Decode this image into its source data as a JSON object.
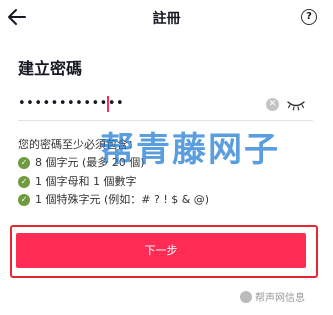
{
  "header": {
    "title": "註冊",
    "help_label": "?"
  },
  "heading": "建立密碼",
  "password": {
    "value": "•••••••••••••",
    "clear_label": "✕"
  },
  "requirements": {
    "title": "您的密碼至少必須包含：",
    "items": [
      {
        "label": "8 個字元 (最多 20 個)"
      },
      {
        "label": "1 個字母和 1 個數字"
      },
      {
        "label": "1 個特殊字元 (例如：# ? ! $ & @)"
      }
    ]
  },
  "watermark": "帮青藤网子",
  "next_button": {
    "label": "下一步"
  },
  "source_mark": {
    "label": "帮声网信息"
  },
  "colors": {
    "primary": "#fe2c55",
    "check": "#6f9a3e",
    "highlight": "#e0292f"
  }
}
